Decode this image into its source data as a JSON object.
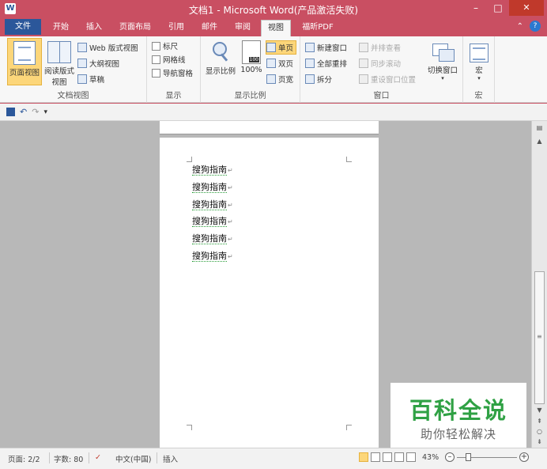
{
  "window": {
    "title": "文档1 - Microsoft Word(产品激活失败)",
    "app_icon_letter": "W",
    "minimize": "–",
    "maximize": "□",
    "close": "✕"
  },
  "tabs": [
    {
      "label": "文件"
    },
    {
      "label": "开始"
    },
    {
      "label": "插入"
    },
    {
      "label": "页面布局"
    },
    {
      "label": "引用"
    },
    {
      "label": "邮件"
    },
    {
      "label": "审阅"
    },
    {
      "label": "视图"
    },
    {
      "label": "福昕PDF"
    }
  ],
  "active_tab": "视图",
  "ribbon": {
    "doc_views": {
      "label": "文档视图",
      "print_layout": "页面视图",
      "reading_line1": "阅读版式",
      "reading_line2": "视图",
      "web_layout": "Web 版式视图",
      "outline": "大纲视图",
      "draft": "草稿"
    },
    "show": {
      "label": "显示",
      "ruler": "标尺",
      "gridlines": "网格线",
      "nav_pane": "导航窗格"
    },
    "zoom": {
      "label": "显示比例",
      "zoom": "显示比例",
      "hundred": "100%",
      "one_page": "单页",
      "two_pages": "双页",
      "page_width": "页宽"
    },
    "window": {
      "label": "窗口",
      "new_window": "新建窗口",
      "arrange_all": "全部重排",
      "split": "拆分",
      "side_by_side": "并排查看",
      "sync_scroll": "同步滚动",
      "reset_position": "重设窗口位置",
      "switch_windows": "切换窗口"
    },
    "macros": {
      "label": "宏",
      "macros": "宏"
    }
  },
  "qat": {
    "undo": "↶",
    "redo": "↷",
    "customize": "▾"
  },
  "document": {
    "lines": [
      "搜狗指南",
      "搜狗指南",
      "搜狗指南",
      "搜狗指南",
      "搜狗指南",
      "搜狗指南"
    ],
    "para_mark": "↵"
  },
  "watermark": {
    "title": "百科全说",
    "subtitle": "助你轻松解决"
  },
  "statusbar": {
    "page": "页面: 2/2",
    "words": "字数: 80",
    "language": "中文(中国)",
    "mode": "插入",
    "zoom": "43%",
    "zoom_minus": "–",
    "zoom_plus": "+"
  }
}
